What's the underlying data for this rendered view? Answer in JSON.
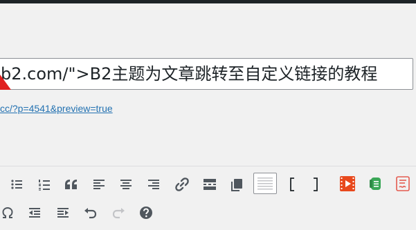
{
  "editor": {
    "title_value": "b2.com/\">B2主题为文章跳转至自定义链接的教程",
    "permalink_text": "cc/?p=4541&preview=true"
  },
  "toolbar": {
    "row1": [
      "bulleted-list",
      "numbered-list",
      "blockquote",
      "align-left",
      "align-center",
      "align-right",
      "insert-link",
      "read-more",
      "toggle-toolbar",
      "horizontal-line",
      "shortcode-bracket-open",
      "shortcode-bracket-close",
      "video-plugin",
      "plugin-green",
      "plugin-red"
    ],
    "row2": [
      "special-character",
      "outdent",
      "indent",
      "undo",
      "redo",
      "help"
    ],
    "icon_colors": {
      "default": "#50575e",
      "video": "#e8491d",
      "green": "#3aa757",
      "red": "#e45a4f"
    }
  }
}
